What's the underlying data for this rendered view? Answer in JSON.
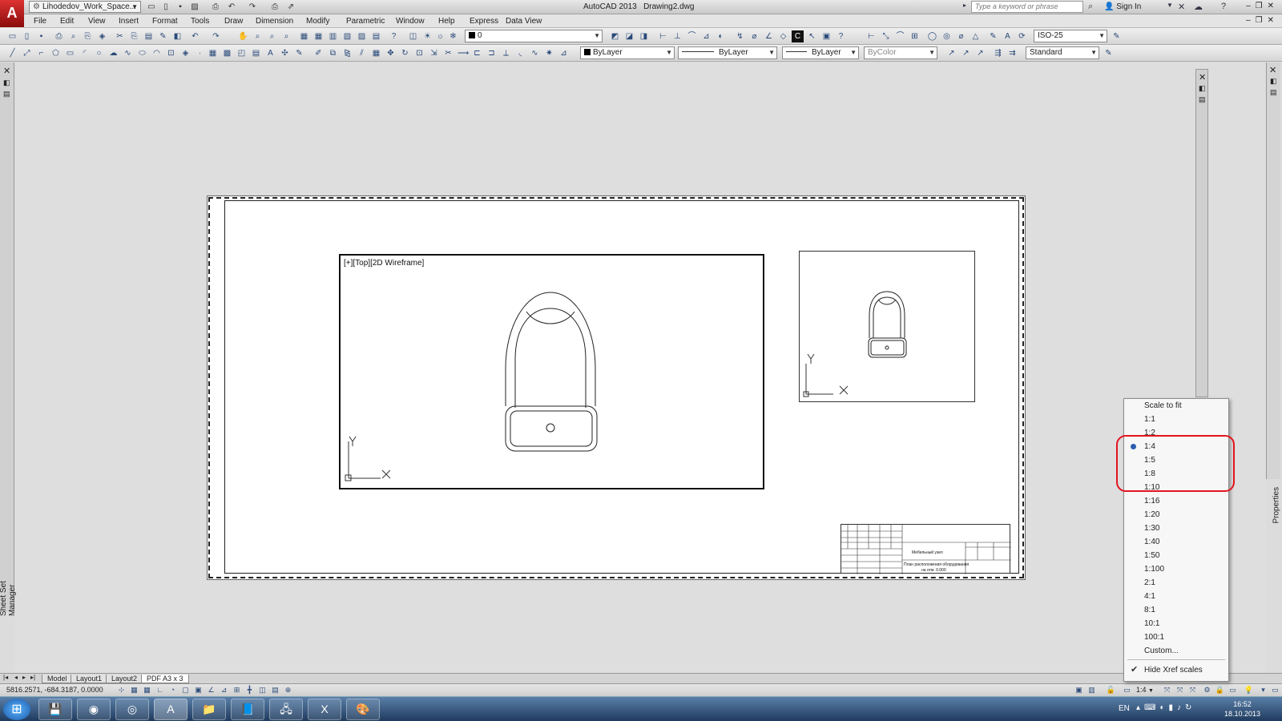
{
  "titlebar": {
    "workspace": "Lihodedov_Work_Space...",
    "app_name": "AutoCAD 2013",
    "file_name": "Drawing2.dwg",
    "search_placeholder": "Type a keyword or phrase",
    "sign_in": "Sign In"
  },
  "menu": [
    "File",
    "Edit",
    "View",
    "Insert",
    "Format",
    "Tools",
    "Draw",
    "Dimension",
    "Modify",
    "Parametric",
    "Window",
    "Help",
    "Express",
    "Data View"
  ],
  "toolbar": {
    "layer_value": "0",
    "dim_style": "ISO-25",
    "color": "ByLayer",
    "linetype": "ByLayer",
    "lineweight": "ByLayer",
    "plot_style": "ByColor",
    "text_style": "Standard"
  },
  "side_panels": {
    "left_label": "Sheet Set Manager",
    "right_label": "Properties"
  },
  "viewport": {
    "label": "[+][Top][2D Wireframe]",
    "axis_x": "X",
    "axis_y": "Y"
  },
  "title_block": {
    "line1": "Мебельный узел",
    "line2": "План расположения оборудования",
    "line3": "на отм. 0.000"
  },
  "layout_tabs": [
    "Model",
    "Layout1",
    "Layout2",
    "PDF A3 x 3"
  ],
  "active_tab": "PDF A3 x 3",
  "status": {
    "coordinates": "5816.2571, -684.3187, 0.0000",
    "scale": "1:4"
  },
  "scale_menu": {
    "items": [
      "Scale to fit",
      "1:1",
      "1:2",
      "1:4",
      "1:5",
      "1:8",
      "1:10",
      "1:16",
      "1:20",
      "1:30",
      "1:40",
      "1:50",
      "1:100",
      "2:1",
      "4:1",
      "8:1",
      "10:1",
      "100:1",
      "Custom...",
      "Hide Xref scales"
    ],
    "selected": "1:4",
    "checked": "Hide Xref scales"
  },
  "taskbar": {
    "language": "EN",
    "time": "16:52",
    "date": "18.10.2013"
  },
  "colors": {
    "highlight": "#e3141f",
    "paper": "#ffffff",
    "workspace_bg": "#dedede"
  }
}
